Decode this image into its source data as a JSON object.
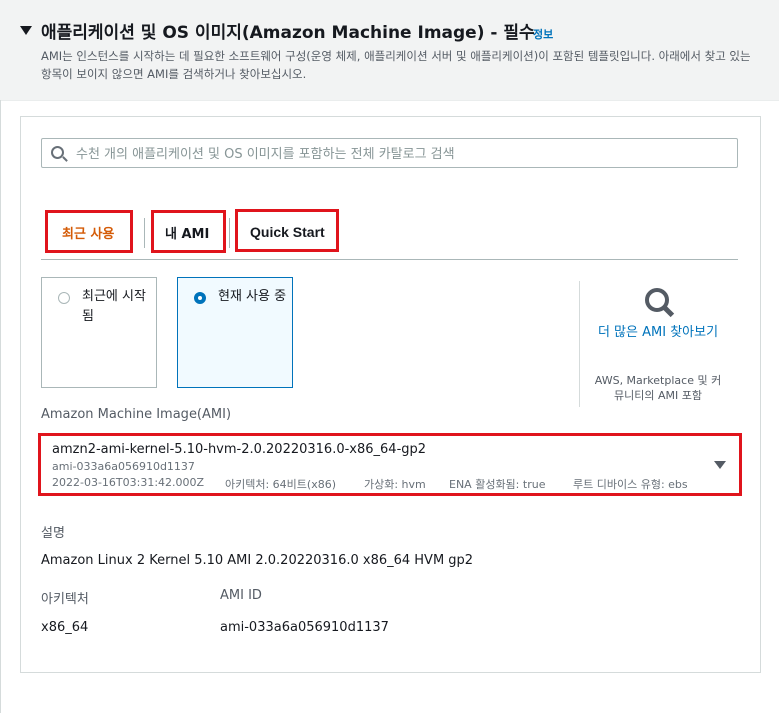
{
  "section": {
    "title": "애플리케이션 및 OS 이미지(Amazon Machine Image) - 필수",
    "info_link": "정보",
    "description": "AMI는 인스턴스를 시작하는 데 필요한 소프트웨어 구성(운영 체제, 애플리케이션 서버 및 애플리케이션)이 포함된 템플릿입니다. 아래에서 찾고 있는 항목이 보이지 않으면 AMI를 검색하거나 찾아보십시오."
  },
  "search": {
    "placeholder": "수천 개의 애플리케이션 및 OS 이미지를 포함하는 전체 카탈로그 검색",
    "value": ""
  },
  "tabs": [
    {
      "label": "최근 사용",
      "active": true
    },
    {
      "label": "내 AMI",
      "active": false
    },
    {
      "label": "Quick Start",
      "active": false
    }
  ],
  "options": [
    {
      "label": "최근에 시작됨",
      "checked": false
    },
    {
      "label": "현재 사용 중",
      "checked": true
    }
  ],
  "browse_more": {
    "link": "더 많은 AMI 찾아보기",
    "subtext": "AWS, Marketplace 및 커뮤니티의 AMI 포함"
  },
  "ami": {
    "label": "Amazon Machine Image(AMI)",
    "name": "amzn2-ami-kernel-5.10-hvm-2.0.20220316.0-x86_64-gp2",
    "id": "ami-033a6a056910d1137",
    "date": "2022-03-16T03:31:42.000Z",
    "architecture": "아키텍처: 64비트(x86)",
    "virtualization": "가상화: hvm",
    "ena": "ENA 활성화됨: true",
    "root_device": "루트 디바이스 유형: ebs"
  },
  "details": {
    "description_label": "설명",
    "description_value": "Amazon Linux 2 Kernel 5.10 AMI 2.0.20220316.0 x86_64 HVM gp2",
    "arch_label": "아키텍처",
    "arch_value": "x86_64",
    "ami_id_label": "AMI ID",
    "ami_id_value": "ami-033a6a056910d1137"
  },
  "colors": {
    "link": "#0073bb",
    "active_tab": "#d45b07",
    "highlight": "#e0141c"
  }
}
